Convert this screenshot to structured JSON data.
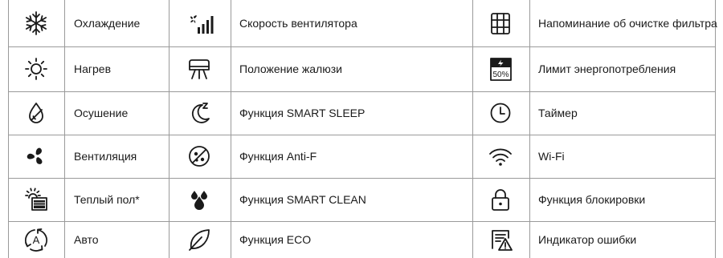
{
  "rows": [
    [
      {
        "icon": "snowflake-icon",
        "label": "Охлаждение"
      },
      {
        "icon": "fan-speed-icon",
        "label": "Скорость вентилятора"
      },
      {
        "icon": "filter-grid-icon",
        "label": "Напоминание об очистке фильтра"
      }
    ],
    [
      {
        "icon": "sun-icon",
        "label": "Нагрев"
      },
      {
        "icon": "louver-position-icon",
        "label": "Положение жалюзи"
      },
      {
        "icon": "power-limit-icon",
        "label": "Лимит энергопотребления",
        "badge": "50%"
      }
    ],
    [
      {
        "icon": "droplet-slash-icon",
        "label": "Осушение"
      },
      {
        "icon": "moon-sleep-icon",
        "label": "Функция SMART SLEEP"
      },
      {
        "icon": "clock-icon",
        "label": "Таймер"
      }
    ],
    [
      {
        "icon": "fan-icon",
        "label": "Вентиляция"
      },
      {
        "icon": "anti-f-icon",
        "label": "Функция Anti-F"
      },
      {
        "icon": "wifi-icon",
        "label": "Wi-Fi"
      }
    ],
    [
      {
        "icon": "heated-floor-icon",
        "label": "Теплый пол*"
      },
      {
        "icon": "drops-icon",
        "label": "Функция SMART CLEAN"
      },
      {
        "icon": "lock-icon",
        "label": "Функция блокировки"
      }
    ],
    [
      {
        "icon": "auto-mode-icon",
        "label": "Авто",
        "badge": "A"
      },
      {
        "icon": "leaf-icon",
        "label": "Функция ECO"
      },
      {
        "icon": "error-indicator-icon",
        "label": "Индикатор ошибки"
      }
    ]
  ]
}
